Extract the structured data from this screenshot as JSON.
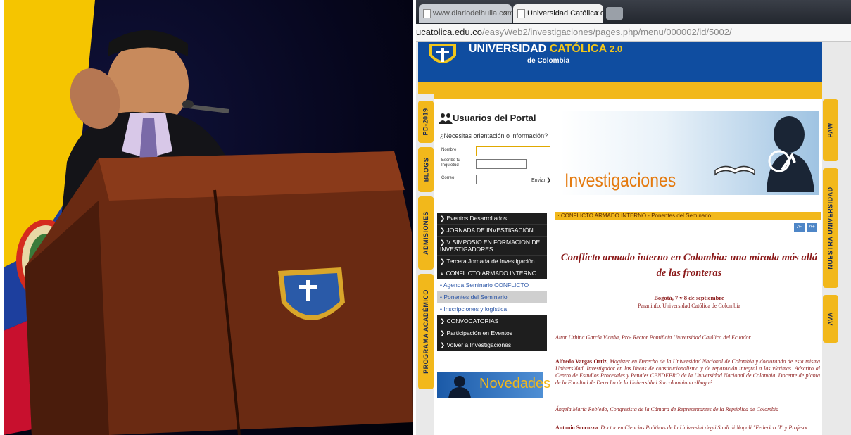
{
  "browser": {
    "tabs": [
      {
        "label": "www.diariodelhuila.com",
        "close": "x",
        "active": false
      },
      {
        "label": "Universidad Católica de C",
        "close": "x",
        "active": true
      }
    ],
    "url_host": "ucatolica.edu.co",
    "url_path": "/easyWeb2/investigaciones/pages.php/menu/000002/id/5002/"
  },
  "site": {
    "name_part1": "UNIVERSIDAD",
    "name_part2": "CATÓLICA",
    "version": "2.0",
    "subtitle": "de Colombia",
    "side_tabs_left": [
      "PD-2019",
      "BLOGS",
      "ADMISIONES",
      "PROGRAMA ACADÉMICO"
    ],
    "side_tabs_right": [
      "PAW",
      "NUESTRA UNIVERSIDAD",
      "AVA"
    ]
  },
  "login": {
    "title": "Usuarios del Portal",
    "question": "¿Necesitas orientación o información?",
    "name_label": "Nombre",
    "concern_label": "Escribe tu Inquietud",
    "email_label": "Correo",
    "send_label": "Enviar"
  },
  "banner": {
    "title": "Investigaciones"
  },
  "menu": {
    "items": [
      {
        "label": "Eventos Desarrollados"
      },
      {
        "label": "JORNADA DE INVESTIGACIÓN"
      },
      {
        "label": "V SIMPOSIO EN FORMACION DE INVESTIGADORES"
      },
      {
        "label": "Tercera Jornada de Investigación"
      },
      {
        "label": "CONFLICTO ARMADO INTERNO"
      },
      {
        "label": "Agenda Seminario CONFLICTO"
      },
      {
        "label": "Ponentes del Seminario"
      },
      {
        "label": "Inscripciones y logística"
      },
      {
        "label": "CONVOCATORIAS"
      },
      {
        "label": "Participación en Eventos"
      },
      {
        "label": "Volver a Investigaciones"
      }
    ],
    "novedades": "Novedades"
  },
  "content": {
    "breadcrumb": "· CONFLICTO ARMADO INTERNO - Ponentes del Seminario",
    "font_minus": "A-",
    "font_plus": "A+",
    "title": "Conflicto armado interno en Colombia: una mirada más allá de las fronteras",
    "date": "Bogotá, 7 y 8 de septiembre",
    "venue": "Paraninfo, Universidad Católica de Colombia",
    "speakers": [
      {
        "name": "",
        "text": "Aitor Urbina García Vicuña, Pro- Rector Pontificia Universidad Católica del Ecuador"
      },
      {
        "name": "Alfredo Vargas Ortiz",
        "text": ", Magíster en Derecho de la Universidad Nacional de Colombia y doctorando de esta misma Universidad. Investigador en las líneas de constitucionalismo y de reparación integral a las víctimas. Adscrito al Centro de Estudios Procesales y Penales CENDEPRO de la Universidad Nacional de Colombia. Docente de planta de la Facultad de Derecho de la Universidad Surcolombiana -Ibagué."
      },
      {
        "name": "",
        "text": "Ángela María Robledo, Congresista de la Cámara de Representantes de la República de Colombia"
      },
      {
        "name": "Antonio Scocozza",
        "text": ". Doctor en Ciencias Políticas de la Università degli Studi di Napoli \"Federico II\" y Profesor"
      }
    ]
  },
  "colors": {
    "blue": "#0f4da0",
    "yellow": "#f2b81b",
    "orange": "#e47b11",
    "maroon": "#8b1a1a"
  }
}
